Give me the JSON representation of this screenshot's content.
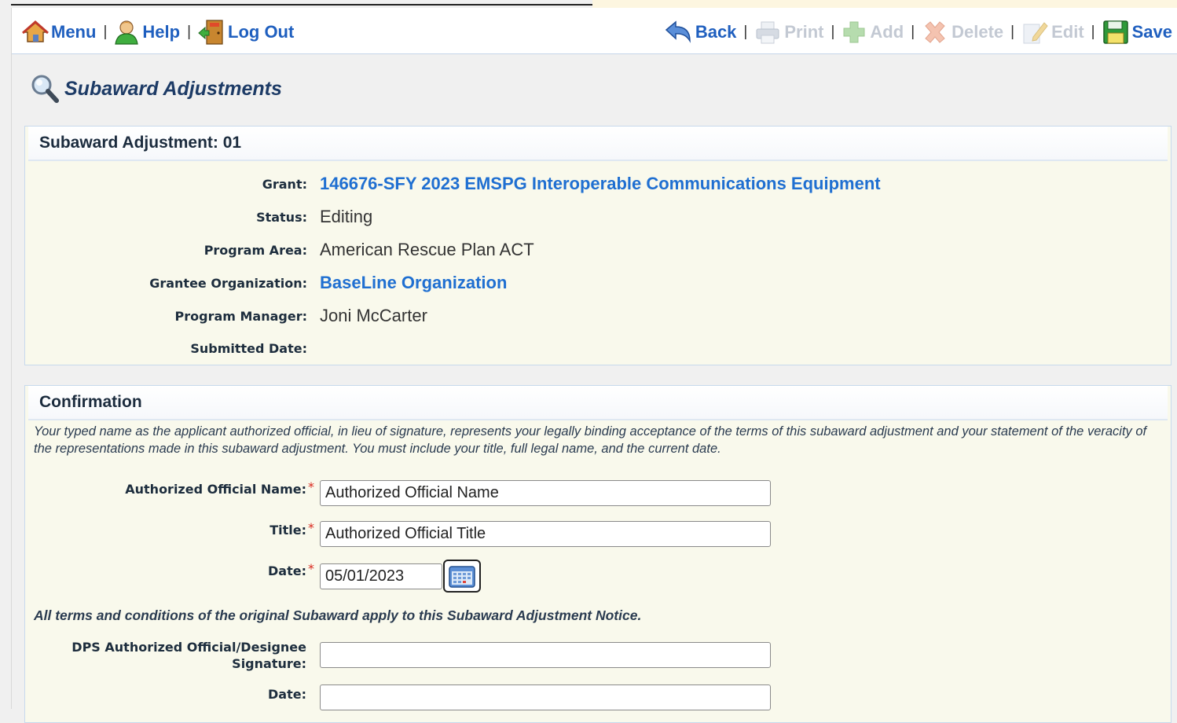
{
  "toolbar": {
    "menu": "Menu",
    "help": "Help",
    "logout": "Log Out",
    "back": "Back",
    "print": "Print",
    "add": "Add",
    "delete": "Delete",
    "edit": "Edit",
    "save": "Save",
    "separator": "|"
  },
  "page": {
    "title": "Subaward Adjustments"
  },
  "summary": {
    "heading": "Subaward Adjustment: 01",
    "fields": [
      {
        "label": "Grant:",
        "value": "146676-SFY 2023 EMSPG Interoperable Communications Equipment"
      },
      {
        "label": "Status:",
        "value": "Editing"
      },
      {
        "label": "Program Area:",
        "value": "American Rescue Plan ACT"
      },
      {
        "label": "Grantee Organization:",
        "value": "BaseLine Organization"
      },
      {
        "label": "Program Manager:",
        "value": "Joni McCarter"
      },
      {
        "label": "Submitted Date:",
        "value": ""
      }
    ]
  },
  "confirmation": {
    "heading": "Confirmation",
    "statement": "Your typed name as the applicant authorized official, in lieu of signature, represents your legally binding acceptance of the terms of this subaward adjustment and your statement of the veracity of the representations made in this subaward adjustment. You must include your title, full legal name, and the current date.",
    "required_mark": "*",
    "official_name_label": "Authorized Official Name:",
    "official_name_value": "Authorized Official Name",
    "title_label": "Title:",
    "title_value": "Authorized Official Title",
    "date_label": "Date:",
    "date_value": "05/01/2023",
    "terms_note": "All terms and conditions of the original Subaward apply to this Subaward Adjustment Notice.",
    "dps_label_line1": "DPS Authorized Official/Designee",
    "dps_label_line2": "Signature:",
    "dps_signature_value": "",
    "dps_date_label": "Date:",
    "dps_date_value": ""
  },
  "colors": {
    "link": "#1f6fd1",
    "panel_bg": "#f9f9ec",
    "title": "#1d3b66",
    "required": "#d9261c"
  },
  "icons": [
    "home-icon",
    "help-person-icon",
    "logout-door-icon",
    "back-arrow-icon",
    "print-icon",
    "add-icon",
    "delete-icon",
    "edit-icon",
    "save-disk-icon",
    "magnifier-icon",
    "calendar-icon"
  ]
}
